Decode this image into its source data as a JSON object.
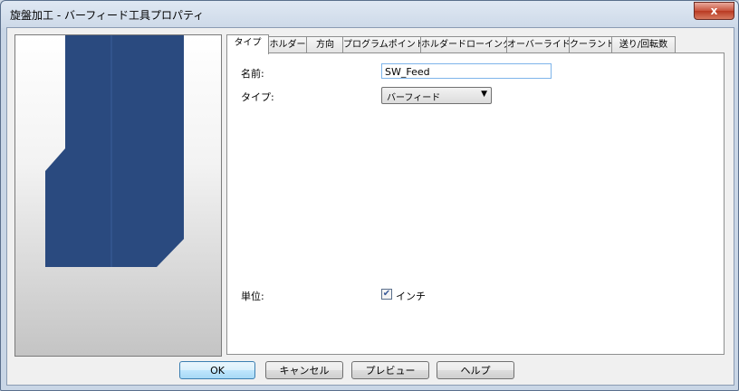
{
  "window": {
    "title": "旋盤加工 - バーフィード工具プロパティ",
    "close_symbol": "x"
  },
  "tabs": [
    "タイプ",
    "ホルダー",
    "方向",
    "プログラムポイント",
    "ホルダードローイング",
    "オーバーライド",
    "クーラント",
    "送り/回転数"
  ],
  "form": {
    "name_label": "名前:",
    "name_value": "SW_Feed",
    "type_label": "タイプ:",
    "type_value": "バーフィード",
    "unit_label": "単位:",
    "unit_checkbox_label": "インチ",
    "unit_checked": true
  },
  "buttons": {
    "ok": "OK",
    "cancel": "キャンセル",
    "preview": "プレビュー",
    "help": "ヘルプ"
  },
  "colors": {
    "tool_fill": "#2a4a7f",
    "tool_line": "#3a5f99"
  }
}
